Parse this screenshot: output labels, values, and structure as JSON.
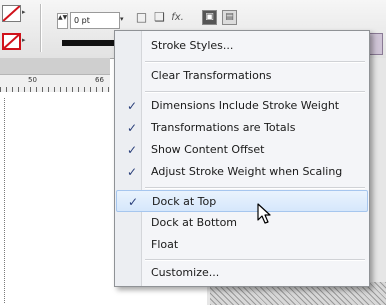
{
  "toolbar": {
    "stroke_weight_value": "0 pt",
    "weight_spinner": "▲▼",
    "dropdown_glyph": "▾",
    "fx_label": "fx.",
    "icons": [
      "fill-swatch-icon",
      "stroke-swatch-icon",
      "align-icon",
      "drop-shadow-icon",
      "effects-icon",
      "frame-fit-icon",
      "text-wrap-icon"
    ]
  },
  "ruler": {
    "labels": [
      "50",
      "66"
    ]
  },
  "menu": {
    "items": [
      {
        "label": "Stroke Styles...",
        "checked": false
      },
      {
        "label": "Clear Transformations",
        "checked": false
      },
      {
        "label": "Dimensions Include Stroke Weight",
        "checked": true
      },
      {
        "label": "Transformations are Totals",
        "checked": true
      },
      {
        "label": "Show Content Offset",
        "checked": true
      },
      {
        "label": "Adjust Stroke Weight when Scaling",
        "checked": true
      },
      {
        "label": "Dock at Top",
        "checked": true,
        "highlighted": true
      },
      {
        "label": "Dock at Bottom",
        "checked": false
      },
      {
        "label": "Float",
        "checked": false
      },
      {
        "label": "Customize...",
        "checked": false
      }
    ],
    "check_glyph": "✓"
  },
  "colors": {
    "swatch_red": "#d0121b",
    "menu_bg": "#f4f5f8",
    "highlight": "#d6e7fb",
    "check": "#2a3f7a"
  }
}
